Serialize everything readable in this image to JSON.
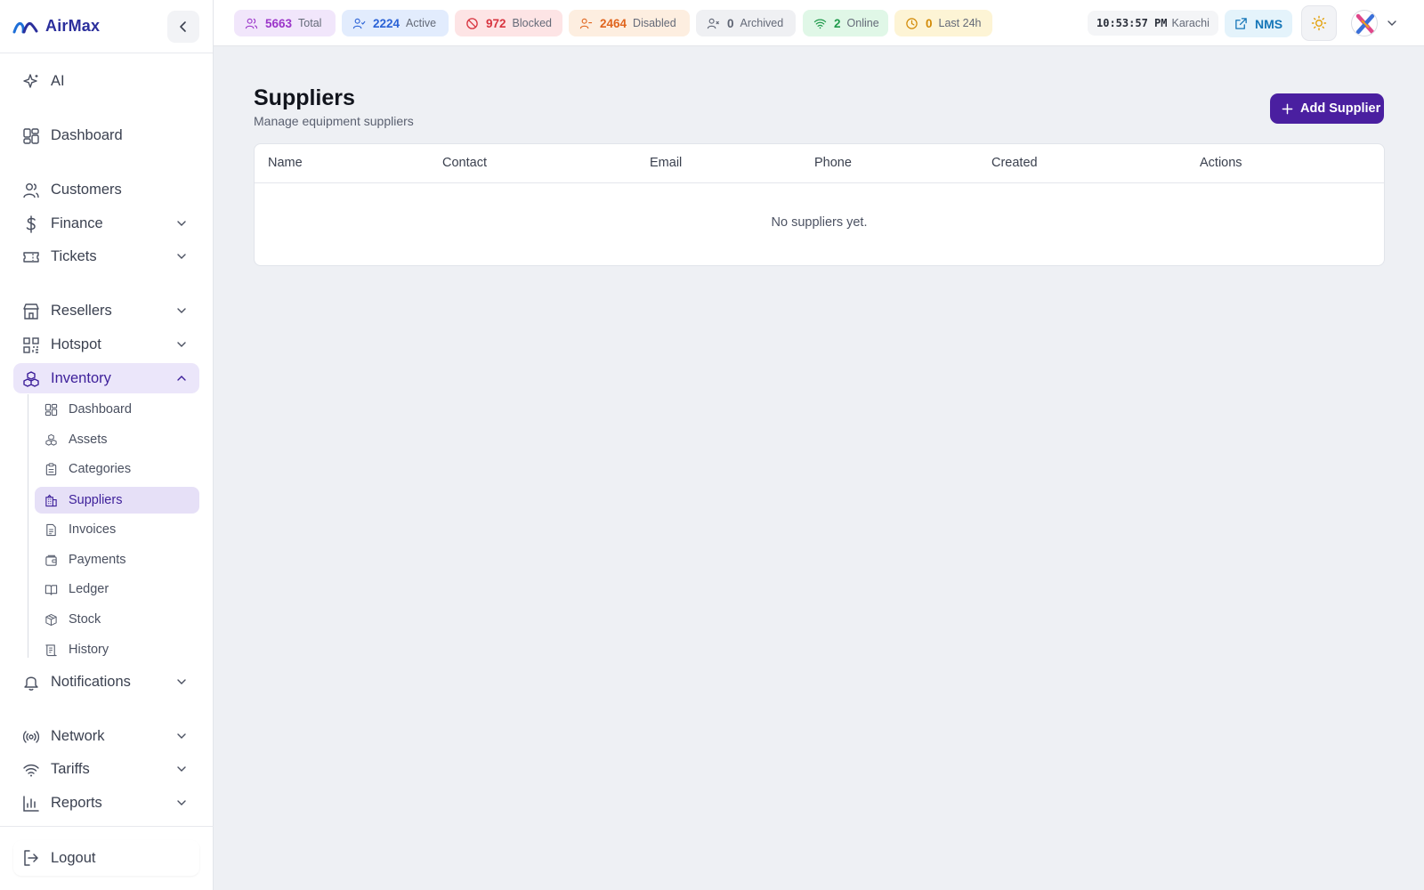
{
  "brand": {
    "name": "AirMax"
  },
  "sidebar": {
    "items": [
      {
        "key": "ai",
        "label": "AI"
      },
      {
        "key": "dashboard",
        "label": "Dashboard"
      },
      {
        "key": "customers",
        "label": "Customers"
      },
      {
        "key": "finance",
        "label": "Finance"
      },
      {
        "key": "tickets",
        "label": "Tickets"
      },
      {
        "key": "resellers",
        "label": "Resellers"
      },
      {
        "key": "hotspot",
        "label": "Hotspot"
      },
      {
        "key": "inventory",
        "label": "Inventory"
      },
      {
        "key": "notifications",
        "label": "Notifications"
      },
      {
        "key": "network",
        "label": "Network"
      },
      {
        "key": "tariffs",
        "label": "Tariffs"
      },
      {
        "key": "reports",
        "label": "Reports"
      }
    ],
    "inventory_sub": [
      {
        "label": "Dashboard"
      },
      {
        "label": "Assets"
      },
      {
        "label": "Categories"
      },
      {
        "label": "Suppliers"
      },
      {
        "label": "Invoices"
      },
      {
        "label": "Payments"
      },
      {
        "label": "Ledger"
      },
      {
        "label": "Stock"
      },
      {
        "label": "History"
      }
    ],
    "logout_label": "Logout"
  },
  "topbar": {
    "stats": [
      {
        "value": "5663",
        "label": "Total",
        "color": "#9b35c9",
        "bg": "#f1e6fb"
      },
      {
        "value": "2224",
        "label": "Active",
        "color": "#2a62d6",
        "bg": "#e2ecfd"
      },
      {
        "value": "972",
        "label": "Blocked",
        "color": "#d8343f",
        "bg": "#fde4e5"
      },
      {
        "value": "2464",
        "label": "Disabled",
        "color": "#e0651e",
        "bg": "#fdeee0"
      },
      {
        "value": "0",
        "label": "Archived",
        "color": "#5d6372",
        "bg": "#eff0f3"
      },
      {
        "value": "2",
        "label": "Online",
        "color": "#1f9a4b",
        "bg": "#e0f7e7"
      },
      {
        "value": "0",
        "label": "Last 24h",
        "color": "#d28a06",
        "bg": "#fdf4d5"
      }
    ],
    "clock_time": "10:53:57 PM",
    "clock_zone": "Karachi",
    "nms_label": "NMS"
  },
  "main": {
    "title": "Suppliers",
    "subtitle": "Manage equipment suppliers",
    "add_button_label": "Add Supplier",
    "table": {
      "columns": [
        "Name",
        "Contact",
        "Email",
        "Phone",
        "Created",
        "Actions"
      ],
      "empty_message": "No suppliers yet."
    }
  },
  "colors": {
    "accent": "#4a1fa0",
    "active_nav_bg": "#ebe6fa",
    "brand_text": "#2b2f9c"
  }
}
